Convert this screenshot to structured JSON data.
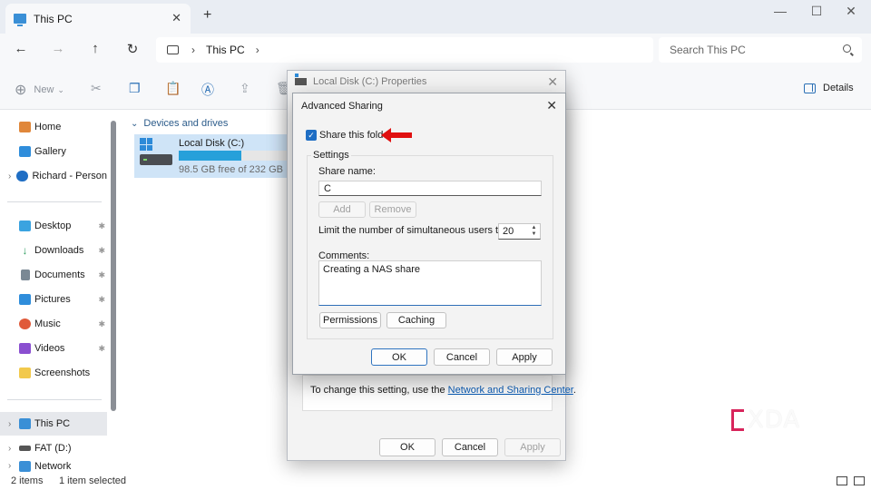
{
  "window": {
    "tab_title": "This PC",
    "tab_close": "✕",
    "new_tab": "+",
    "minimize": "—",
    "maximize": "☐",
    "close": "✕"
  },
  "nav": {
    "back": "←",
    "forward": "→",
    "up": "↑",
    "refresh": "↻",
    "chevron": "›",
    "address_location": "This PC",
    "search_placeholder": "Search This PC"
  },
  "toolbar": {
    "new_label": "New",
    "new_dropdown": "⌄",
    "details_label": "Details"
  },
  "sidebar": {
    "items": [
      {
        "label": "Home",
        "icon": "home-icon",
        "color": "#e0873a"
      },
      {
        "label": "Gallery",
        "icon": "gallery-icon",
        "color": "#2f8ddb"
      },
      {
        "label": "Richard - Person",
        "icon": "onedrive-icon",
        "color": "#1f6ec4"
      },
      {
        "label": "Desktop",
        "icon": "desktop-icon",
        "color": "#3aa3e0"
      },
      {
        "label": "Downloads",
        "icon": "download-icon",
        "color": "#2d9b5e"
      },
      {
        "label": "Documents",
        "icon": "documents-icon",
        "color": "#7a8894"
      },
      {
        "label": "Pictures",
        "icon": "pictures-icon",
        "color": "#2f8ddb"
      },
      {
        "label": "Music",
        "icon": "music-icon",
        "color": "#e05a3a"
      },
      {
        "label": "Videos",
        "icon": "videos-icon",
        "color": "#8a4fd0"
      },
      {
        "label": "Screenshots",
        "icon": "folder-icon",
        "color": "#f2c94c"
      },
      {
        "label": "This PC",
        "icon": "this-pc-icon",
        "color": "#3a8fd6"
      },
      {
        "label": "FAT (D:)",
        "icon": "drive-icon",
        "color": "#555555"
      },
      {
        "label": "Network",
        "icon": "network-icon",
        "color": "#3a8fd6"
      }
    ],
    "expand_chevron": "›",
    "pin_glyph": "📌"
  },
  "main": {
    "group_header": "Devices and drives",
    "group_chevron": "⌄",
    "drive": {
      "name": "Local Disk (C:)",
      "free_text": "98.5 GB free of 232 GB",
      "used_fraction": 0.575
    }
  },
  "statusbar": {
    "item_count": "2 items",
    "selection": "1 item selected"
  },
  "properties_dialog": {
    "title": "Local Disk (C:) Properties",
    "close": "✕",
    "message_prefix": "To change this setting, use the ",
    "message_link": "Network and Sharing Center",
    "message_suffix": ".",
    "ok_label": "OK",
    "cancel_label": "Cancel",
    "apply_label": "Apply"
  },
  "advanced_sharing": {
    "title": "Advanced Sharing",
    "close": "✕",
    "share_checkbox_label": "Share this folder",
    "share_checked": true,
    "check_glyph": "✓",
    "settings_legend": "Settings",
    "share_name_label": "Share name:",
    "share_name_value": "C",
    "add_label": "Add",
    "remove_label": "Remove",
    "limit_label": "Limit the number of simultaneous users to:",
    "limit_value": "20",
    "stepper_up": "▲",
    "stepper_down": "▼",
    "comments_label": "Comments:",
    "comments_value": "Creating a NAS share",
    "permissions_label": "Permissions",
    "caching_label": "Caching",
    "ok_label": "OK",
    "cancel_label": "Cancel",
    "apply_label": "Apply",
    "arrow_color": "#e01010"
  },
  "watermark": {
    "text": "XDA",
    "accent": "#d8245b"
  }
}
